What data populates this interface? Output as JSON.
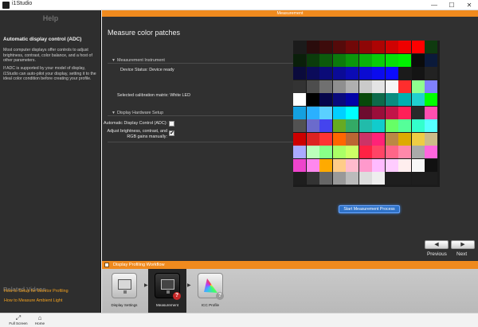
{
  "window": {
    "title": "i1Studio",
    "min": "—",
    "max": "☐",
    "close": "✕"
  },
  "help": {
    "title": "Help",
    "heading": "Automatic display control (ADC)",
    "body1": "Most computer displays offer controls to adjust brightness, contrast, color balance, and a host of other parameters.",
    "body2": "If ADC is supported by your model of display, i1Studio can auto-pilot your display, setting it to the ideal color condition before creating your profile.",
    "related_title": "Related Videos",
    "links": [
      "How to Setup for Monitor Profiling",
      "How to Measure Ambient Light"
    ]
  },
  "main": {
    "header": "Measurement",
    "title": "Measure color patches",
    "instrument": {
      "section": "Measurement Instrument",
      "status_label": "Device Status:",
      "status_value": "Device ready",
      "matrix_label": "Selected calibration matrix:",
      "matrix_value": "White LED"
    },
    "hardware": {
      "section": "Display Hardware Setup",
      "adc_label": "Automatic Display Control (ADC):",
      "adc_checked": false,
      "manual_label": "Adjust brightness, contrast, and RGB gains manually:",
      "manual_checked": true
    },
    "start_button": "Start Measurement Process",
    "nav": {
      "prev_icon": "◀",
      "next_icon": "▶",
      "previous": "Previous",
      "next": "Next"
    }
  },
  "workflow": {
    "title": "Display Profiling Workflow",
    "arrow": "▶",
    "steps": [
      {
        "label": "Display Settings",
        "active": false
      },
      {
        "label": "Measurement",
        "active": true,
        "badge": "?"
      },
      {
        "label": "ICC Profile",
        "active": false,
        "badge": "?"
      }
    ]
  },
  "bottom": {
    "fullscreen": {
      "icon": "⤢",
      "label": "Full Screen"
    },
    "home": {
      "icon": "⌂",
      "label": "Home"
    }
  },
  "patches": {
    "cols": 11,
    "colors": [
      "#1b1b1b",
      "#2a0c0c",
      "#3d0b0b",
      "#550a0a",
      "#710808",
      "#8e0606",
      "#ad0404",
      "#cf0202",
      "#ef0000",
      "#ff0000",
      "#0f3a0f",
      "#0a1f0a",
      "#0b3c0b",
      "#0c5a0c",
      "#0c7a0c",
      "#0b960b",
      "#0ab20a",
      "#09cc09",
      "#07e007",
      "#00f000",
      "#0b0b0b",
      "#0b1a3a",
      "#0b0b3c",
      "#0b0b5a",
      "#0b0b78",
      "#0b0b96",
      "#0b0bb4",
      "#0b0bd2",
      "#0b0bee",
      "#0b0bff",
      "#1b1b1b",
      "#141414",
      "#222222",
      "#333333",
      "#4d4d4d",
      "#707070",
      "#8f8f8f",
      "#afafaf",
      "#cacaca",
      "#e4e4e4",
      "#f6f6f6",
      "#ff2d2d",
      "#8fff8f",
      "#8080ff",
      "#ffffff",
      "#000000",
      "#05054a",
      "#0a0a7c",
      "#0303a6",
      "#08480a",
      "#0c6a4a",
      "#0a8c80",
      "#00b0b0",
      "#20d0d0",
      "#00ff00",
      "#14a0e0",
      "#2ab0ff",
      "#5ad0ff",
      "#00d0ff",
      "#00ffff",
      "#6d0c2f",
      "#9a0e3a",
      "#c21448",
      "#ff1f58",
      "#2a2a2a",
      "#ff4fb0",
      "#525252",
      "#6b6bcc",
      "#4444ee",
      "#66aa22",
      "#33aa66",
      "#22bbaa",
      "#11cccc",
      "#66ff66",
      "#55ff99",
      "#33ffcc",
      "#55ffff",
      "#cc0000",
      "#dd2222",
      "#ff3333",
      "#ff6600",
      "#bb6633",
      "#cc3366",
      "#ff2277",
      "#bb8844",
      "#ddaa00",
      "#eecc44",
      "#ccbb88",
      "#aaaaff",
      "#bbffbb",
      "#88ff88",
      "#aaff66",
      "#ccff66",
      "#ff2244",
      "#ff4466",
      "#ff6688",
      "#ff88aa",
      "#aaaaaa",
      "#ff66dd",
      "#ee44cc",
      "#ff88ee",
      "#ffaa00",
      "#ffcc88",
      "#ffbbcc",
      "#ff99cc",
      "#ffbbff",
      "#ffccff",
      "#ffeeee",
      "#f8f8f8",
      "#111111",
      "#1e1e1e",
      "#333333",
      "#666666",
      "#999999",
      "#bbbbbb",
      "#dddddd",
      "#eeeeee",
      "#1e1e1e",
      "#1e1e1e",
      "#1e1e1e",
      "#1e1e1e"
    ]
  }
}
